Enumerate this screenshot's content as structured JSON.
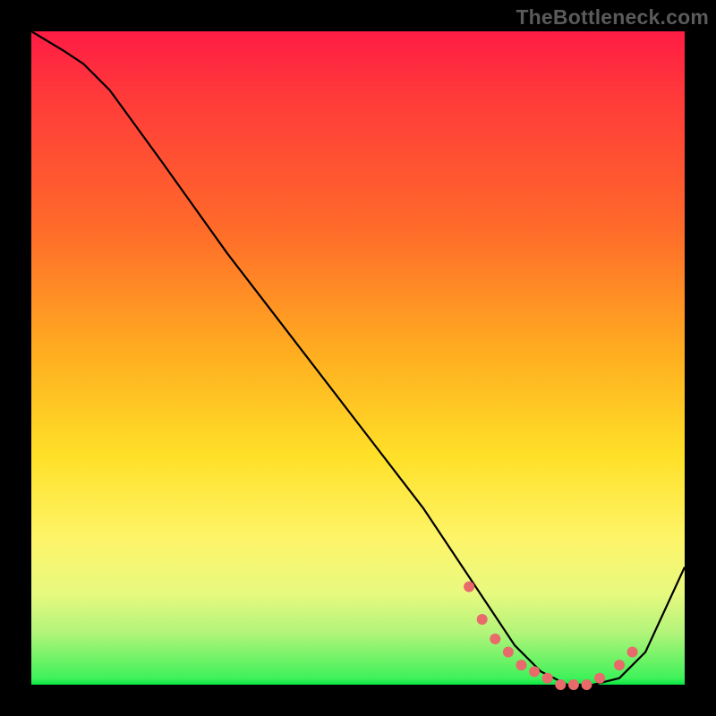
{
  "watermark": "TheBottleneck.com",
  "chart_data": {
    "type": "line",
    "title": "",
    "xlabel": "",
    "ylabel": "",
    "xlim": [
      0,
      100
    ],
    "ylim": [
      0,
      100
    ],
    "grid": false,
    "legend": false,
    "series": [
      {
        "name": "bottleneck-curve",
        "x": [
          0,
          5,
          8,
          12,
          20,
          30,
          40,
          50,
          60,
          66,
          70,
          74,
          78,
          82,
          86,
          90,
          94,
          100
        ],
        "y": [
          100,
          97,
          95,
          91,
          80,
          66,
          53,
          40,
          27,
          18,
          12,
          6,
          2,
          0,
          0,
          1,
          5,
          18
        ]
      }
    ],
    "markers": {
      "name": "floor-dots",
      "points": [
        {
          "x": 67,
          "y": 15
        },
        {
          "x": 69,
          "y": 10
        },
        {
          "x": 71,
          "y": 7
        },
        {
          "x": 73,
          "y": 5
        },
        {
          "x": 75,
          "y": 3
        },
        {
          "x": 77,
          "y": 2
        },
        {
          "x": 79,
          "y": 1
        },
        {
          "x": 81,
          "y": 0
        },
        {
          "x": 83,
          "y": 0
        },
        {
          "x": 85,
          "y": 0
        },
        {
          "x": 87,
          "y": 1
        },
        {
          "x": 90,
          "y": 3
        },
        {
          "x": 92,
          "y": 5
        }
      ]
    },
    "background_gradient": {
      "top": "#ff1c44",
      "mid": "#ffe028",
      "bottom": "#08e642"
    }
  }
}
